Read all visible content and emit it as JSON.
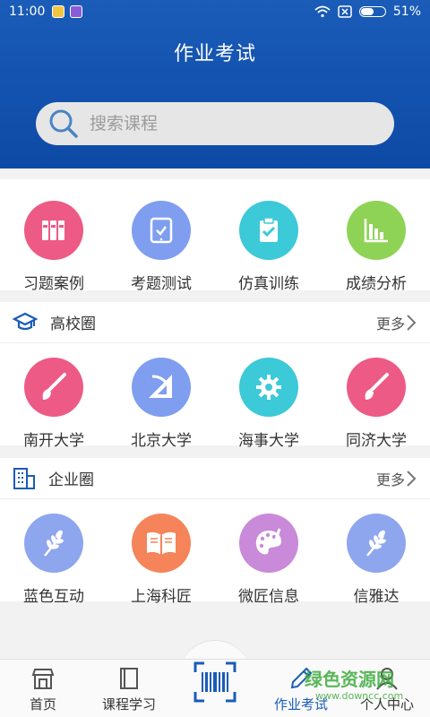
{
  "status": {
    "time": "11:00",
    "battery": "51%",
    "battery_level": 0.51
  },
  "header": {
    "title": "作业考试"
  },
  "search": {
    "placeholder": "搜索课程"
  },
  "quick": [
    {
      "label": "习题案例",
      "color": "#ec5a85",
      "icon": "binders-icon"
    },
    {
      "label": "考题测试",
      "color": "#7f9ef0",
      "icon": "tablet-icon"
    },
    {
      "label": "仿真训练",
      "color": "#3cc9d8",
      "icon": "clipboard-check-icon"
    },
    {
      "label": "成绩分析",
      "color": "#8fd356",
      "icon": "bar-chart-icon"
    }
  ],
  "schools": {
    "title": "高校圈",
    "more": "更多",
    "items": [
      {
        "label": "南开大学",
        "color": "#ec5a85",
        "icon": "brush-icon"
      },
      {
        "label": "北京大学",
        "color": "#7f9ef0",
        "icon": "ruler-icon"
      },
      {
        "label": "海事大学",
        "color": "#3cc9d8",
        "icon": "gear-icon"
      },
      {
        "label": "同济大学",
        "color": "#ec5a85",
        "icon": "brush-icon"
      }
    ]
  },
  "companies": {
    "title": "企业圈",
    "more": "更多",
    "items": [
      {
        "label": "蓝色互动",
        "color": "#8ea6ee",
        "icon": "wheat-icon"
      },
      {
        "label": "上海科匠",
        "color": "#f5845a",
        "icon": "book-icon"
      },
      {
        "label": "微匠信息",
        "color": "#c98ad9",
        "icon": "palette-icon"
      },
      {
        "label": "信雅达",
        "color": "#8ea6ee",
        "icon": "wheat-icon"
      }
    ]
  },
  "nav": [
    {
      "label": "首页",
      "icon": "shop-icon"
    },
    {
      "label": "课程学习",
      "icon": "book-icon"
    },
    {
      "label": "",
      "icon": "barcode-scan-icon"
    },
    {
      "label": "作业考试",
      "icon": "pencil-icon",
      "active": true
    },
    {
      "label": "个人中心",
      "icon": "person-icon"
    }
  ],
  "watermark": {
    "text": "绿色资源网",
    "url": "www.downcc.com"
  },
  "colors": {
    "brand": "#1a5cb8"
  }
}
